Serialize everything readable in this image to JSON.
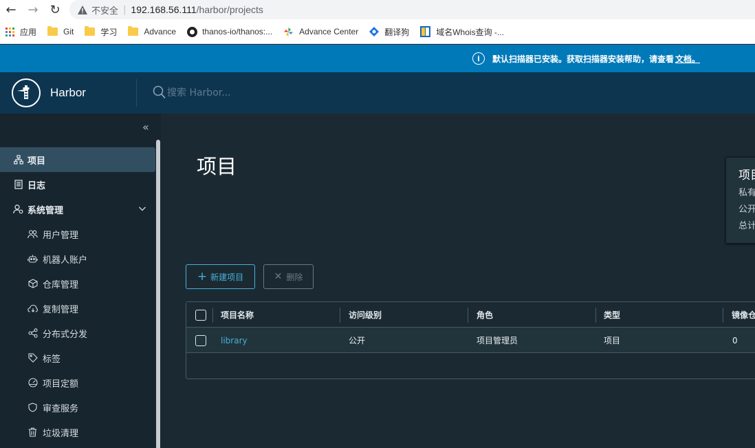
{
  "browser": {
    "insecure_label": "不安全",
    "url_host": "192.168.56.111",
    "url_path": "/harbor/projects",
    "bookmarks": {
      "apps": "应用",
      "b1": "Git",
      "b2": "学习",
      "b3": "Advance",
      "b4": "thanos-io/thanos:...",
      "b5": "Advance Center",
      "b6": "翻译狗",
      "b7": "域名Whois查询 -..."
    }
  },
  "banner": {
    "message": "默认扫描器已安装。获取扫描器安装帮助，请查看",
    "link": "文档。"
  },
  "header": {
    "brand": "Harbor",
    "search_placeholder": "搜索 Harbor..."
  },
  "sidebar": {
    "items": [
      {
        "label": "项目",
        "icon": "projects-icon"
      },
      {
        "label": "日志",
        "icon": "logs-icon"
      },
      {
        "label": "系统管理",
        "icon": "admin-icon"
      },
      {
        "label": "用户管理",
        "icon": "users-icon"
      },
      {
        "label": "机器人账户",
        "icon": "robot-icon"
      },
      {
        "label": "仓库管理",
        "icon": "registry-icon"
      },
      {
        "label": "复制管理",
        "icon": "replication-icon"
      },
      {
        "label": "分布式分发",
        "icon": "distribution-icon"
      },
      {
        "label": "标签",
        "icon": "tag-icon"
      },
      {
        "label": "项目定额",
        "icon": "quota-icon"
      },
      {
        "label": "审查服务",
        "icon": "interrogation-icon"
      },
      {
        "label": "垃圾清理",
        "icon": "trash-icon"
      }
    ]
  },
  "main": {
    "title": "项目",
    "summary": {
      "title": "项目",
      "lines": [
        "私有",
        "公开",
        "总计"
      ]
    },
    "buttons": {
      "new": "新建项目",
      "delete": "删除"
    },
    "table": {
      "columns": [
        "项目名称",
        "访问级别",
        "角色",
        "类型",
        "镜像仓库"
      ],
      "rows": [
        {
          "name": "library",
          "access": "公开",
          "role": "项目管理员",
          "type": "项目",
          "repos": "0"
        }
      ]
    }
  },
  "colors": {
    "banner": "#0079b8",
    "header": "#0e3550",
    "sidebar": "#17252e",
    "content": "#1b2a32",
    "accent": "#49afd9"
  }
}
